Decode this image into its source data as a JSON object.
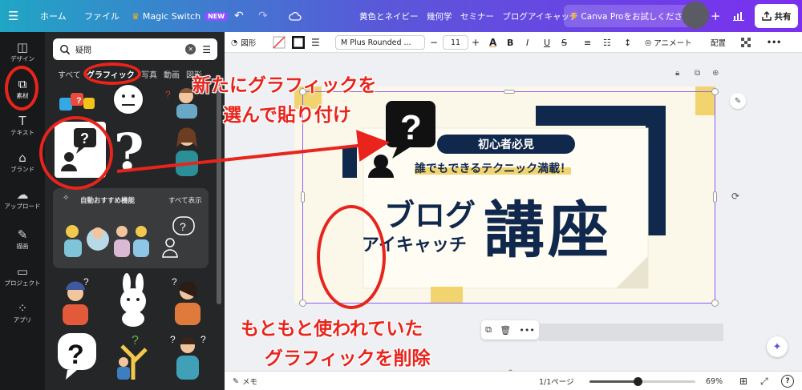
{
  "topbar": {
    "menu_icon": "hamburger-icon",
    "home": "ホーム",
    "file": "ファイル",
    "magic_switch": "Magic Switch",
    "magic_badge": "NEW",
    "undo_icon": "undo-icon",
    "redo_icon": "redo-icon",
    "cloud_icon": "cloud-saved-icon",
    "title": "黄色とネイビー　幾何学　セミナー　ブログアイキャッチ",
    "pro_button": "Canva Proをお試しください",
    "add": "+",
    "share": "共有"
  },
  "rail": [
    {
      "label": "デザイン",
      "icon": "layout-icon"
    },
    {
      "label": "素材",
      "icon": "shapes-icon"
    },
    {
      "label": "テキスト",
      "icon": "text-icon"
    },
    {
      "label": "ブランド",
      "icon": "brand-icon"
    },
    {
      "label": "アップロード",
      "icon": "upload-icon"
    },
    {
      "label": "描画",
      "icon": "draw-icon"
    },
    {
      "label": "プロジェクト",
      "icon": "folder-icon"
    },
    {
      "label": "アプリ",
      "icon": "apps-icon"
    }
  ],
  "panel": {
    "search_value": "疑問",
    "tabs": [
      "すべて",
      "グラフィック",
      "写真",
      "動画",
      "図形"
    ],
    "auto_title": "自動おすすめ機能",
    "auto_all": "すべて表示"
  },
  "toolbar": {
    "shapes": "図形",
    "font": "M Plus Rounded ...",
    "minus": "−",
    "size": "11",
    "plus": "+",
    "bold": "B",
    "italic": "I",
    "underline": "U",
    "strike": "S",
    "animate": "アニメート",
    "position": "配置",
    "more": "•••"
  },
  "canvas": {
    "headline": "初心者必見",
    "subline": "誰でもできるテクニック満載！",
    "blog": "ブログ",
    "eyecatch": "アイキャッチ",
    "course": "講座"
  },
  "bottombar": {
    "memo": "メモ",
    "pages": "1/1ページ",
    "zoom": "69%",
    "zoom_level": 0.69,
    "help": "?"
  },
  "annotations": {
    "top_line1": "新たにグラフィックを",
    "top_line2": "選んで貼り付け",
    "bottom_line1": "もともと使われていた",
    "bottom_line2": "グラフィックを削除"
  },
  "colors": {
    "navy": "#11284d",
    "yellow": "#f2d46f",
    "cream": "#fbf8ea",
    "red": "#e8241c",
    "purple_select": "#8b5cf6"
  }
}
